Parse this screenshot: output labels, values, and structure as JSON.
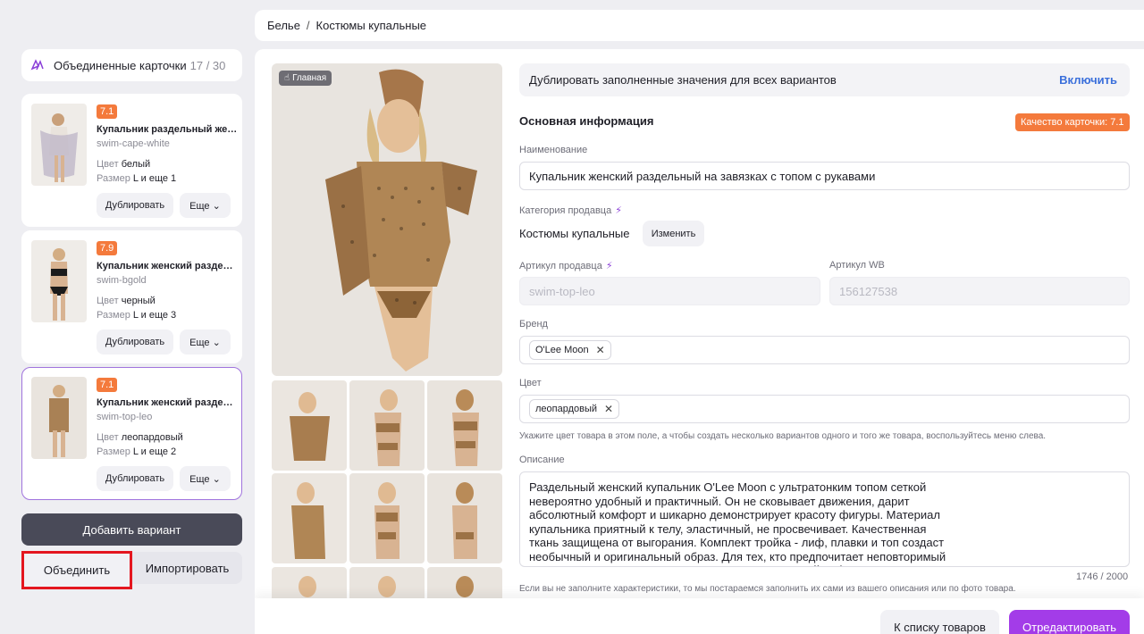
{
  "breadcrumb": {
    "items": [
      "Белье",
      "Костюмы купальные"
    ]
  },
  "sidebar": {
    "header": {
      "title": "Объединенные карточки",
      "count": "17 / 30"
    },
    "cards": [
      {
        "badge": "7.1",
        "name": "Купальник раздельный женск...",
        "sku": "swim-cape-white",
        "color_label": "Цвет",
        "color": "белый",
        "size_label": "Размер",
        "size": "L и еще 1",
        "duplicate": "Дублировать",
        "more": "Еще"
      },
      {
        "badge": "7.9",
        "name": "Купальник женский раздель...",
        "sku": "swim-bgold",
        "color_label": "Цвет",
        "color": "черный",
        "size_label": "Размер",
        "size": "L и еще 3",
        "duplicate": "Дублировать",
        "more": "Еще"
      },
      {
        "badge": "7.1",
        "name": "Купальник женский раздель...",
        "sku": "swim-top-leo",
        "color_label": "Цвет",
        "color": "леопардовый",
        "size_label": "Размер",
        "size": "L и еще 2",
        "duplicate": "Дублировать",
        "more": "Еще"
      }
    ],
    "add_variant": "Добавить вариант",
    "combine": "Объединить",
    "import": "Импортировать"
  },
  "gallery": {
    "main_tag": "Главная"
  },
  "form": {
    "duplicate_bar": {
      "text": "Дублировать заполненные значения для всех вариантов",
      "action": "Включить"
    },
    "section_title": "Основная информация",
    "quality": "Качество карточки: 7.1",
    "name_label": "Наименование",
    "name_value": "Купальник женский раздельный на завязках с топом с рукавами",
    "category_label": "Категория продавца",
    "category_value": "Костюмы купальные",
    "change": "Изменить",
    "seller_sku_label": "Артикул продавца",
    "seller_sku_value": "swim-top-leo",
    "wb_sku_label": "Артикул WB",
    "wb_sku_value": "156127538",
    "brand_label": "Бренд",
    "brand_value": "O'Lee Moon",
    "color_label": "Цвет",
    "color_value": "леопардовый",
    "color_hint": "Укажите цвет товара в этом поле, а чтобы создать несколько вариантов одного и того же товара, воспользуйтесь меню слева.",
    "desc_label": "Описание",
    "description": "Раздельный женский купальник O'Lee Moon с ультратонким топом сеткой невероятно удобный и практичный. Он не сковывает движения, дарит абсолютный комфорт и шикарно демонстрирует красоту фигуры. Материал купальника приятный к телу, эластичный, не просвечивает. Качественная ткань защищена от выгорания. Комплект тройка - лиф, плавки и топ создаст необычный и оригинальный образ. Для тех, кто предпочитает неповторимый стиль – это идеальная модель купальника. Открытый лиф на тонких бретелях",
    "counter": "1746 / 2000",
    "ai_hint": "Если вы не заполните характеристики, то мы постараемся заполнить их сами из вашего описания или по фото товара."
  },
  "footer": {
    "back": "К списку товаров",
    "edit": "Отредактировать"
  },
  "colors": {
    "accent": "#a33ce8",
    "badge": "#f47a3c",
    "link": "#3a6fdb",
    "highlight": "#e4161f"
  }
}
